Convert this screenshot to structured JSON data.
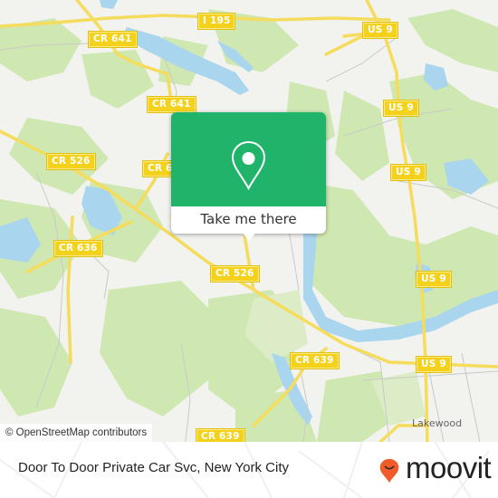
{
  "map": {
    "attribution": "© OpenStreetMap contributors",
    "colors": {
      "land": "#f2f2ef",
      "park": "#cfe8b2",
      "park_light": "#dcecc6",
      "water": "#a9d5ee",
      "road": "#f5dc5c",
      "road_minor": "#c9c9c9",
      "shield": "#f4d21c"
    },
    "road_shields": [
      {
        "label": "I 195",
        "id": "i-195"
      },
      {
        "label": "CR 641",
        "id": "cr-641-a"
      },
      {
        "label": "CR 641",
        "id": "cr-641-b"
      },
      {
        "label": "CR 6",
        "id": "cr-6-partial"
      },
      {
        "label": "CR 526",
        "id": "cr-526-a"
      },
      {
        "label": "CR 636",
        "id": "cr-636"
      },
      {
        "label": "CR 526",
        "id": "cr-526-b"
      },
      {
        "label": "CR 639",
        "id": "cr-639-a"
      },
      {
        "label": "CR 639",
        "id": "cr-639-b"
      },
      {
        "label": "US 9",
        "id": "us-9-a"
      },
      {
        "label": "US 9",
        "id": "us-9-b"
      },
      {
        "label": "US 9",
        "id": "us-9-c"
      },
      {
        "label": "US 9",
        "id": "us-9-d"
      },
      {
        "label": "US 9",
        "id": "us-9-e"
      }
    ],
    "place_labels": [
      {
        "label": "Lakewood"
      }
    ]
  },
  "popup": {
    "icon": "map-pin-icon",
    "button_label": "Take me there",
    "color": "#1fb46a"
  },
  "footer": {
    "title": "Door To Door Private Car Svc, New York City",
    "brand": "moovit",
    "brand_color": "#f15a29"
  }
}
